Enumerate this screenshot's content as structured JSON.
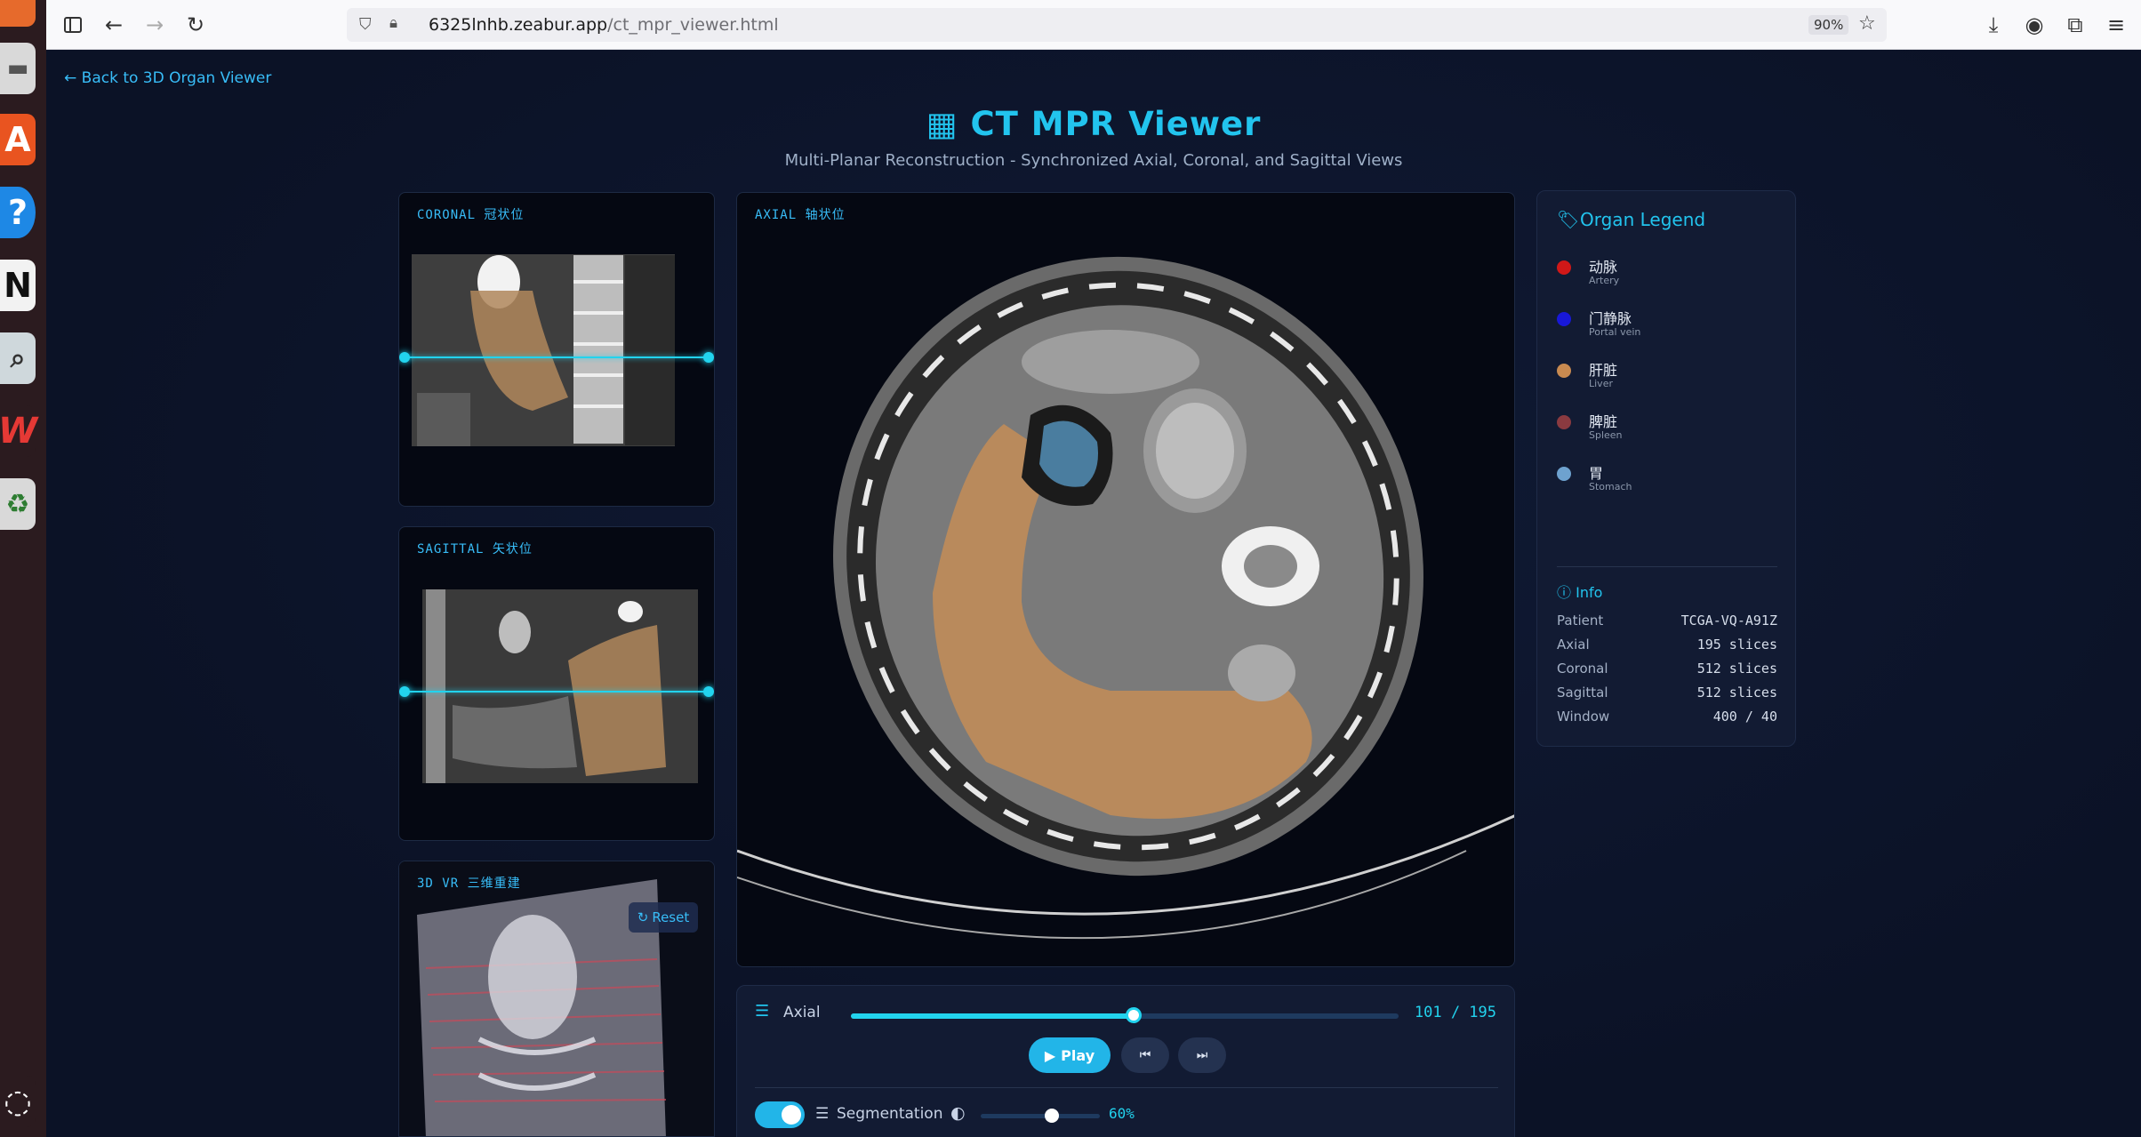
{
  "browser": {
    "url_host": "6325lnhb.zeabur.app",
    "url_path": "/ct_mpr_viewer.html",
    "zoom": "90%"
  },
  "page": {
    "back_link": "Back to 3D Organ Viewer",
    "title": "CT MPR Viewer",
    "subtitle": "Multi-Planar Reconstruction - Synchronized Axial, Coronal, and Sagittal Views"
  },
  "views": {
    "coronal_label": "CORONAL 冠状位",
    "sagittal_label": "SAGITTAL 矢状位",
    "vr_label": "3D VR 三维重建",
    "axial_label": "AXIAL 轴状位",
    "reset_label": "Reset"
  },
  "legend": {
    "title": "Organ Legend",
    "items": [
      {
        "zh": "动脉",
        "en": "Artery",
        "color": "#d01818"
      },
      {
        "zh": "门静脉",
        "en": "Portal vein",
        "color": "#1818d8"
      },
      {
        "zh": "肝脏",
        "en": "Liver",
        "color": "#c88a50"
      },
      {
        "zh": "脾脏",
        "en": "Spleen",
        "color": "#8a3a40"
      },
      {
        "zh": "胃",
        "en": "Stomach",
        "color": "#6ea2cf"
      }
    ]
  },
  "info": {
    "title": "Info",
    "rows": [
      {
        "key": "Patient",
        "value": "TCGA-VQ-A91Z"
      },
      {
        "key": "Axial",
        "value": "195 slices"
      },
      {
        "key": "Coronal",
        "value": "512 slices"
      },
      {
        "key": "Sagittal",
        "value": "512 slices"
      },
      {
        "key": "Window",
        "value": "400 / 40"
      }
    ]
  },
  "controls": {
    "axial_label": "Axial",
    "slice_counter": "101 / 195",
    "slice_current": 101,
    "slice_total": 195,
    "play_label": "Play",
    "segmentation_label": "Segmentation",
    "segmentation_enabled": true,
    "opacity_label": "60%",
    "opacity": 0.6
  },
  "colors": {
    "accent": "#22c4ee",
    "background": "#0b1226",
    "panel": "#121b33"
  }
}
